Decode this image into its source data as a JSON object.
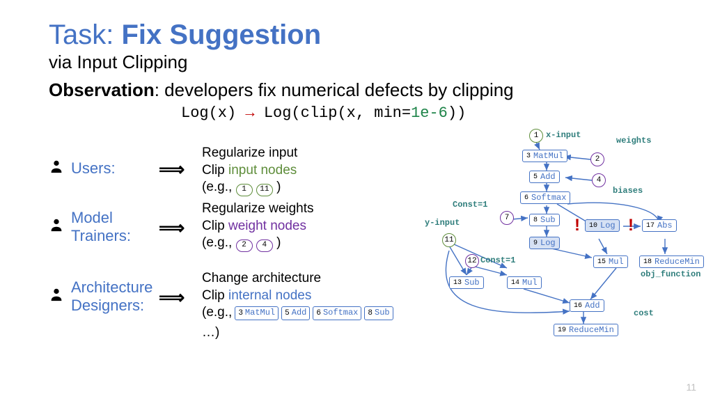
{
  "title_prefix": "Task:",
  "title_bold": "Fix Suggestion",
  "subtitle": "via Input Clipping",
  "observation_label": "Observation",
  "observation_text": ": developers fix numerical defects by clipping",
  "code_line": {
    "lhs": "Log(x)",
    "arrow": "→",
    "rhs_pre": "Log(clip(x, min=",
    "rhs_num": "1e-6",
    "rhs_post": "))"
  },
  "roles": {
    "users": {
      "label": "Users:",
      "implies": "⟹"
    },
    "trainers": {
      "label": "Model\nTrainers:",
      "implies": "⟹"
    },
    "designers": {
      "label": "Architecture\nDesigners:",
      "implies": "⟹"
    }
  },
  "desc": {
    "users": {
      "l1": "Regularize input",
      "l2a": "Clip ",
      "l2b": "input nodes",
      "eg": "(e.g., ",
      "chips": [
        "1",
        "11"
      ],
      "end": ")"
    },
    "trainers": {
      "l1": "Regularize weights",
      "l2a": "Clip ",
      "l2b": "weight nodes",
      "eg": "(e.g., ",
      "chips": [
        "2",
        "4"
      ],
      "end": ")"
    },
    "designers": {
      "l1": "Change architecture",
      "l2a": "Clip ",
      "l2b": "internal nodes",
      "eg": "(e.g., ",
      "boxes": [
        {
          "id": "3",
          "name": "MatMul"
        },
        {
          "id": "5",
          "name": "Add"
        },
        {
          "id": "6",
          "name": "Softmax"
        },
        {
          "id": "8",
          "name": "Sub"
        }
      ],
      "end": "…)"
    }
  },
  "diagram": {
    "labels": {
      "x_input": "x-input",
      "y_input": "y-input",
      "weights": "weights",
      "biases": "biases",
      "cost": "cost",
      "obj": "obj_function",
      "const1a": "Const=1",
      "const1b": "Const=1"
    },
    "circles": {
      "n1": "1",
      "n2": "2",
      "n4": "4",
      "n7": "7",
      "n11": "11",
      "n12": "12"
    },
    "nodes": {
      "n3": {
        "id": "3",
        "name": "MatMul"
      },
      "n5": {
        "id": "5",
        "name": "Add"
      },
      "n6": {
        "id": "6",
        "name": "Softmax"
      },
      "n8": {
        "id": "8",
        "name": "Sub"
      },
      "n9": {
        "id": "9",
        "name": "Log"
      },
      "n10": {
        "id": "10",
        "name": "Log"
      },
      "n13": {
        "id": "13",
        "name": "Sub"
      },
      "n14": {
        "id": "14",
        "name": "Mul"
      },
      "n15": {
        "id": "15",
        "name": "Mul"
      },
      "n16": {
        "id": "16",
        "name": "Add"
      },
      "n17": {
        "id": "17",
        "name": "Abs"
      },
      "n18": {
        "id": "18",
        "name": "ReduceMin"
      },
      "n19": {
        "id": "19",
        "name": "ReduceMin"
      }
    },
    "exclaim": "!"
  },
  "page_number": "11"
}
